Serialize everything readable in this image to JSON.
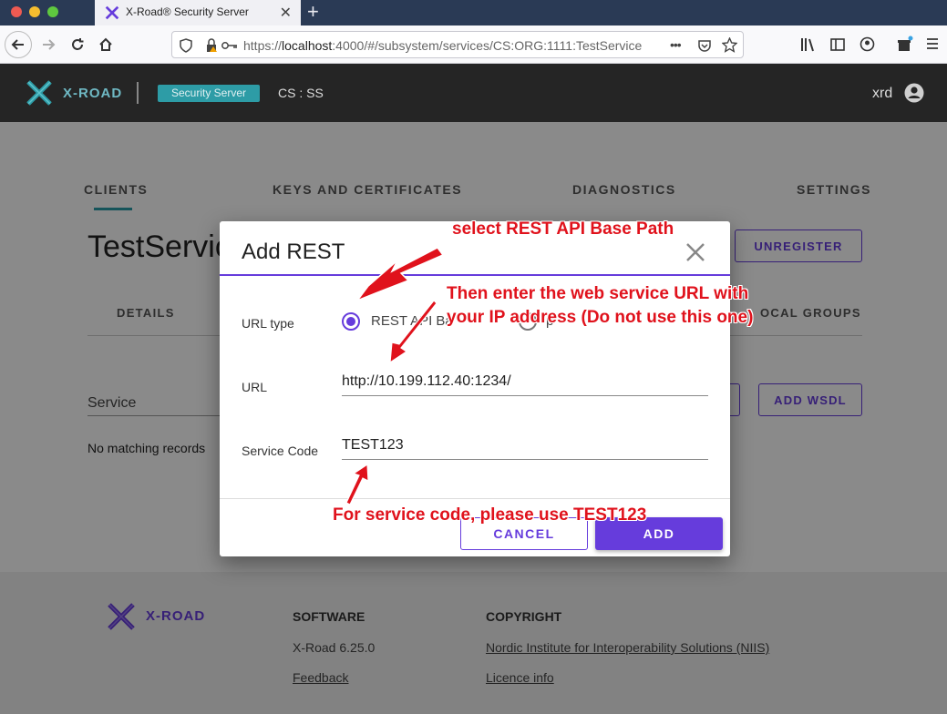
{
  "browser": {
    "tab_title": "X-Road® Security Server",
    "url_prefix": "https://",
    "url_host": "localhost",
    "url_rest": ":4000/#/subsystem/services/CS:ORG:1111:TestService",
    "new_tab_symbol": "+",
    "tab_close_symbol": "✕",
    "more_symbol": "•••"
  },
  "header": {
    "logo_text": "X-ROAD",
    "badge": "Security Server",
    "instance": "CS : SS",
    "user": "xrd"
  },
  "main": {
    "tabs": [
      "CLIENTS",
      "KEYS AND CERTIFICATES",
      "DIAGNOSTICS",
      "SETTINGS"
    ],
    "page_title": "TestServic",
    "unregister_label": "UNREGISTER",
    "subtabs": [
      "DETAILS",
      "OCAL GROUPS"
    ],
    "service_label": "Service",
    "no_records": "No matching records",
    "add_wsdl_label": "ADD WSDL"
  },
  "dialog": {
    "title": "Add REST",
    "url_type_label": "URL type",
    "radio_option_1": "REST API Ba",
    "radio_option_2": "p",
    "url_label": "URL",
    "url_value": "http://10.199.112.40:1234/",
    "service_code_label": "Service Code",
    "service_code_value": "TEST123",
    "cancel_label": "CANCEL",
    "add_label": "ADD"
  },
  "footer": {
    "logo_text": "X-ROAD",
    "software_heading": "SOFTWARE",
    "version": "X-Road 6.25.0",
    "feedback": "Feedback",
    "copyright_heading": "COPYRIGHT",
    "org": "Nordic Institute for Interoperability Solutions (NIIS)",
    "licence": "Licence info"
  },
  "annotations": {
    "select_rest": "select REST API Base Path",
    "enter_url_line1": "Then enter the web service URL with",
    "enter_url_line2": "your IP address (Do not use this one)",
    "service_code_note": "For service code, please use TEST123"
  },
  "colors": {
    "accent": "#663cdc",
    "teal": "#2d9ca6",
    "annotation": "#e0121c",
    "header_bg": "#252525"
  }
}
